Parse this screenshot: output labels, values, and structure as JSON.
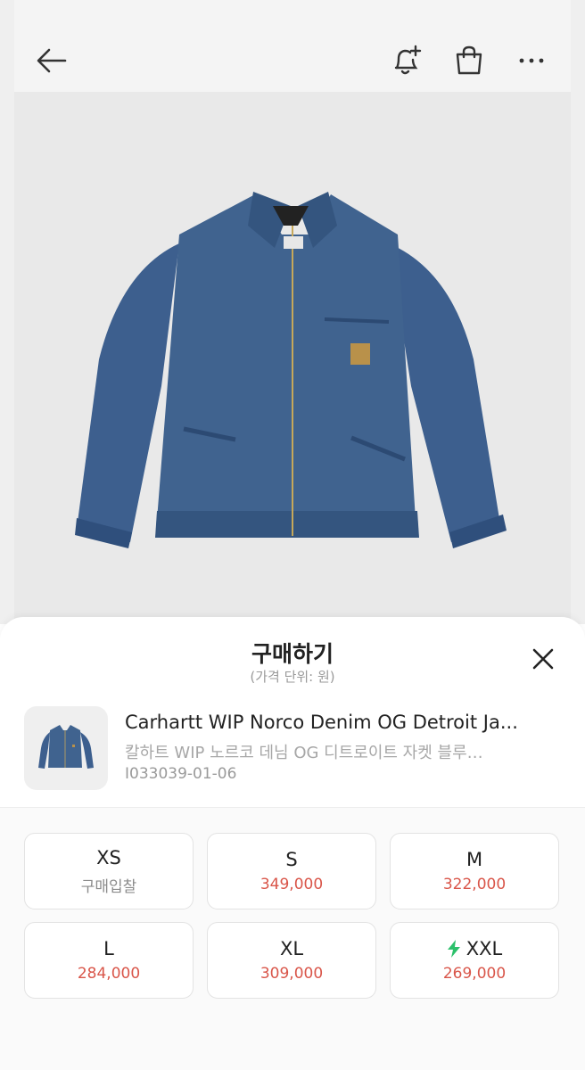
{
  "nav": {
    "back_icon": "arrow-left-icon",
    "bell_icon": "bell-plus-icon",
    "bag_icon": "shopping-bag-icon",
    "more_icon": "more-horizontal-icon"
  },
  "hero": {
    "image": "denim-jacket-product-photo"
  },
  "sheet": {
    "title": "구매하기",
    "subtitle": "(가격 단위: 원)",
    "close_icon": "close-icon"
  },
  "product": {
    "name_en": "Carhartt WIP Norco Denim OG Detroit Ja...",
    "name_ko": "칼하트 WIP 노르코 데님 OG 디트로이트 자켓 블루…",
    "code": "I033039-01-06"
  },
  "sizes": [
    {
      "label": "XS",
      "price": "구매입찰",
      "muted": true,
      "fast": false
    },
    {
      "label": "S",
      "price": "349,000",
      "muted": false,
      "fast": false
    },
    {
      "label": "M",
      "price": "322,000",
      "muted": false,
      "fast": false
    },
    {
      "label": "L",
      "price": "284,000",
      "muted": false,
      "fast": false
    },
    {
      "label": "XL",
      "price": "309,000",
      "muted": false,
      "fast": false
    },
    {
      "label": "XXL",
      "price": "269,000",
      "muted": false,
      "fast": true
    }
  ],
  "colors": {
    "price_red": "#d9564a",
    "fast_green": "#2bc06a",
    "denim": "#3b5f8f"
  }
}
